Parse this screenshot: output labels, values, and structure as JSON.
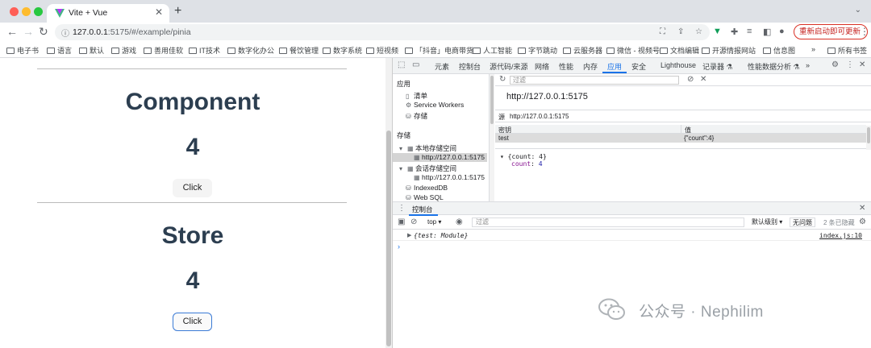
{
  "browser": {
    "tab_title": "Vite + Vue",
    "url_host": "127.0.0.1",
    "url_rest": ":5175/#/example/pinia",
    "update_button": "重新启动即可更新",
    "traffic_colors": [
      "#ff5f57",
      "#febc2e",
      "#28c840"
    ]
  },
  "bookmarks": [
    "电子书",
    "语言",
    "默认",
    "游戏",
    "善用佳软",
    "IT技术",
    "数字化办公",
    "餐饮管理",
    "数字系统",
    "短视频",
    "「抖音」电商带货",
    "人工智能",
    "字节跳动",
    "云服务器",
    "微信 - 视频号",
    "文档编辑",
    "开源情报网站",
    "信息图",
    "»",
    "所有书签"
  ],
  "page": {
    "component_title": "Component",
    "component_count": "4",
    "component_button": "Click",
    "store_title": "Store",
    "store_count": "4",
    "store_button": "Click"
  },
  "devtools": {
    "tabs": [
      "元素",
      "控制台",
      "源代码/来源",
      "网络",
      "性能",
      "内存",
      "应用",
      "安全",
      "Lighthouse",
      "记录器 ⚗",
      "性能数据分析 ⚗",
      "»"
    ],
    "active_tab": "应用",
    "sidebar": {
      "app_header": "应用",
      "manifest": "清单",
      "service_workers": "Service Workers",
      "storage_item": "存储",
      "storage_header": "存储",
      "local_storage": "本地存储空间",
      "local_origin": "http://127.0.0.1:5175",
      "session_storage": "会话存储空间",
      "session_origin": "http://127.0.0.1:5175",
      "indexeddb": "IndexedDB",
      "websql": "Web SQL"
    },
    "filter_placeholder": "过滤",
    "origin_title": "http://127.0.0.1:5175",
    "source_label": "源",
    "source_value": "http://127.0.0.1:5175",
    "table": {
      "col_key": "密钥",
      "col_value": "值",
      "row_key": "test",
      "row_value": "{\"count\":4}"
    },
    "preview_line1": "{count: 4}",
    "preview_key": "count",
    "preview_val": "4",
    "console": {
      "title": "控制台",
      "context": "top",
      "filter_placeholder": "过滤",
      "level": "默认级别",
      "issues": "无问题",
      "hidden": "2 条已隐藏",
      "log_text": "{test: Module}",
      "log_source": "index.js:10"
    }
  },
  "watermark": "公众号 · Nephilim"
}
